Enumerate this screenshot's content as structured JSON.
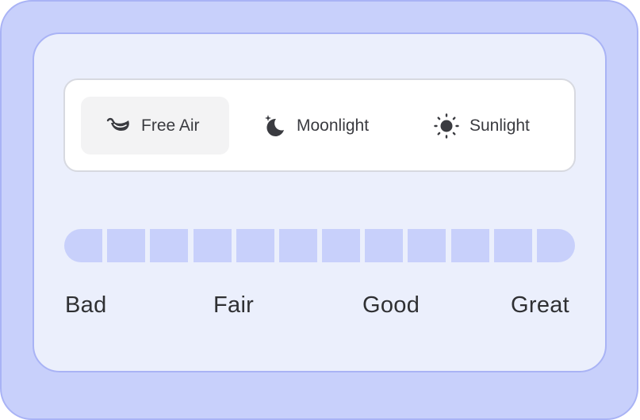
{
  "tabs": [
    {
      "label": "Free Air",
      "icon": "leaf-icon",
      "active": true
    },
    {
      "label": "Moonlight",
      "icon": "moon-icon",
      "active": false
    },
    {
      "label": "Sunlight",
      "icon": "sun-icon",
      "active": false
    }
  ],
  "meter": {
    "segments": 12,
    "selected": 0,
    "labels": [
      "Bad",
      "Fair",
      "Good",
      "Great"
    ]
  },
  "colors": {
    "frame": "#c8d0fb",
    "card": "#ebeffc",
    "accent": "#a9b3f5",
    "text": "#3a3b40"
  }
}
